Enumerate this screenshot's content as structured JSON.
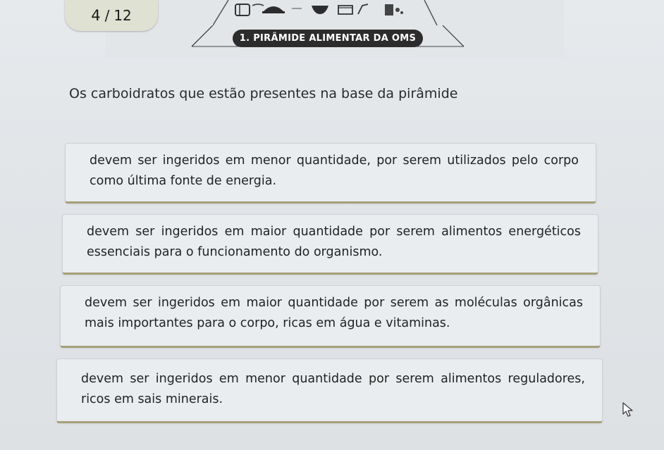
{
  "header": {
    "current_page": "4",
    "separator": "/",
    "total_pages": "12",
    "banner_label": "1. PIRÂMIDE ALIMENTAR DA OMS"
  },
  "question": {
    "text": "Os carboidratos que estão presentes na base da pirâmide"
  },
  "options": [
    {
      "text": "devem ser ingeridos em menor quantidade, por serem utilizados pelo corpo como última fonte de energia."
    },
    {
      "text": "devem ser ingeridos em maior quantidade por serem alimentos energéticos essenciais para o funcionamento do organismo."
    },
    {
      "text": "devem ser ingeridos em maior quantidade por serem as moléculas orgânicas mais importantes para o corpo, ricas em água e vitaminas."
    },
    {
      "text": "devem ser ingeridos em menor quantidade por serem alimentos reguladores, ricos em sais minerais."
    }
  ],
  "icons": {
    "pyramid_foods": "food-pyramid-icons",
    "cursor": "mouse-pointer-icon"
  },
  "colors": {
    "banner_bg": "#2c2c2c",
    "counter_bg": "#dfe1d2",
    "option_accent": "#a6a07a"
  }
}
